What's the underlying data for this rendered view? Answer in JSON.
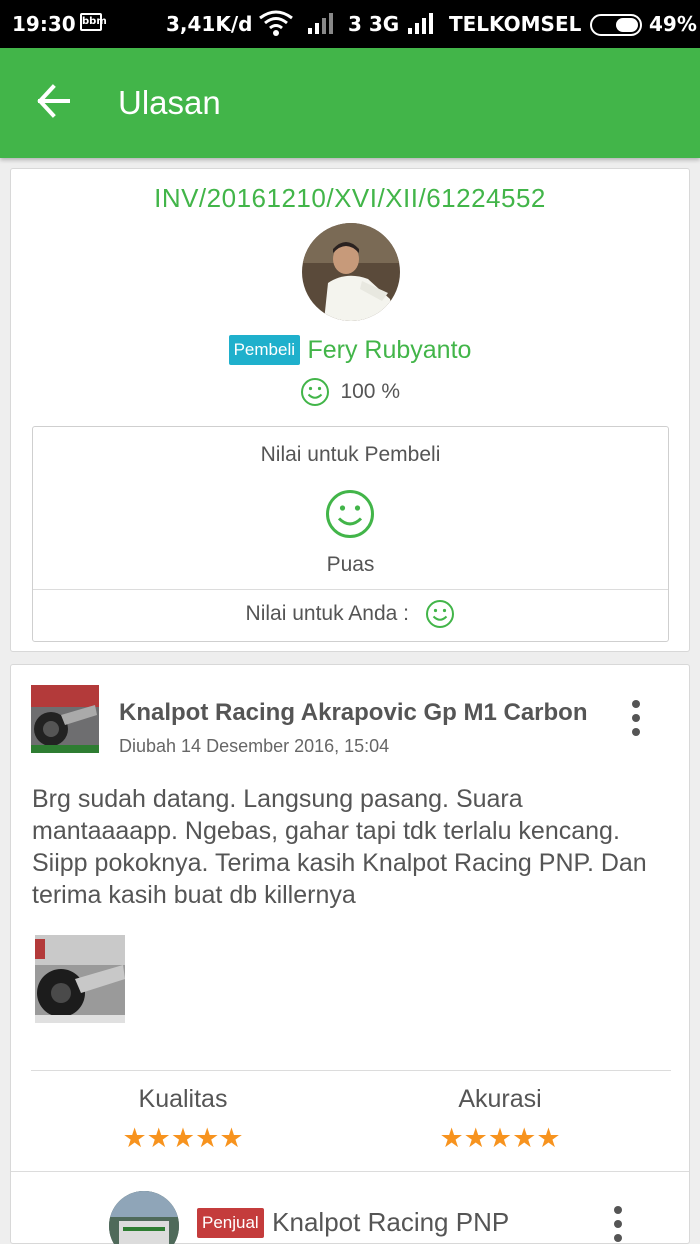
{
  "status_bar": {
    "time": "19:30",
    "bbm": "bbm",
    "speed": "3,41K/d",
    "network": "3 3G",
    "carrier": "TELKOMSEL",
    "battery": "49%",
    "battery_level": 0.49
  },
  "appbar": {
    "title": "Ulasan",
    "back_icon": "arrow-left-icon"
  },
  "transaction": {
    "invoice": "INV/20161210/XVI/XII/61224552",
    "buyer": {
      "role_badge": "Pembeli",
      "name": "Fery Rubyanto",
      "reputation": "100 %",
      "reputation_icon": "smile-icon"
    },
    "rating": {
      "title": "Nilai untuk Pembeli",
      "result_icon": "smile-icon",
      "result": "Puas",
      "your_rating_label": "Nilai untuk Anda :"
    }
  },
  "review": {
    "product_name": "Knalpot Racing Akrapovic Gp M1 Carbon",
    "date": "Diubah 14 Desember 2016, 15:04",
    "text": "Brg sudah datang. Langsung pasang. Suara mantaaaapp. Ngebas, gahar tapi tdk terlalu kencang. Siipp pokoknya. Terima kasih Knalpot Racing PNP. Dan terima kasih buat db killernya",
    "scores": [
      {
        "label": "Kualitas",
        "stars": 5,
        "max": 5
      },
      {
        "label": "Akurasi",
        "stars": 5,
        "max": 5
      }
    ],
    "seller": {
      "role_badge": "Penjual",
      "name": "Knalpot Racing PNP"
    }
  },
  "colors": {
    "accent": "#42b549",
    "buyer_badge": "#1fb0cc",
    "seller_badge": "#c43c3c",
    "star": "#f7931e"
  }
}
